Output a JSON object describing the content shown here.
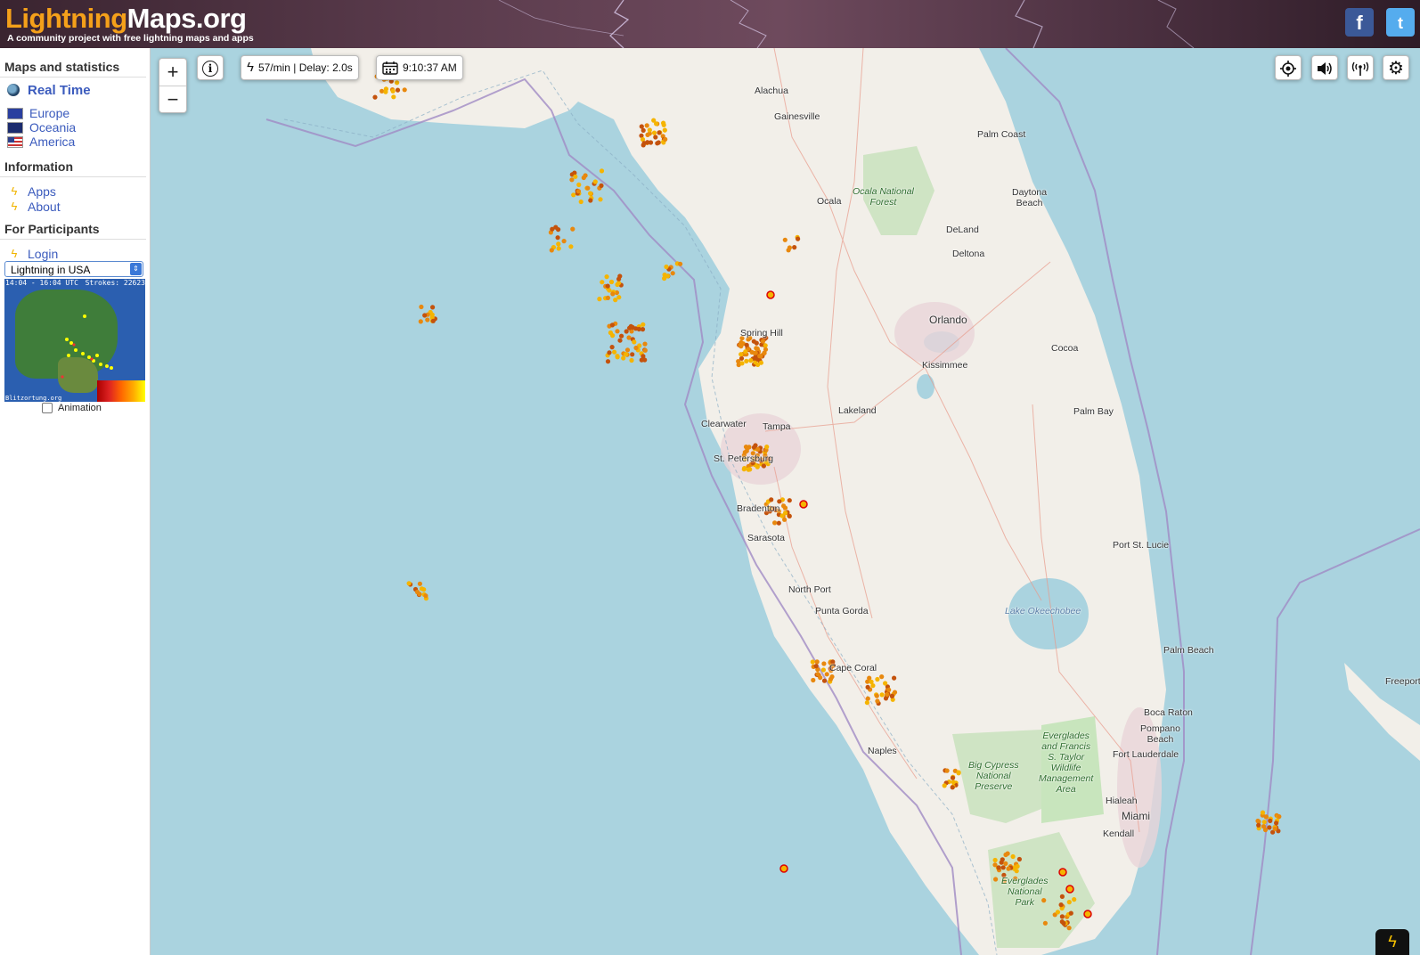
{
  "header": {
    "logo_part1": "Lightning",
    "logo_part2": "Maps.org",
    "tagline": "A community project with free lightning maps and apps",
    "facebook_glyph": "f",
    "twitter_glyph": "t"
  },
  "sidebar": {
    "section_maps": "Maps and statistics",
    "realtime": "Real Time",
    "regions": [
      "Europe",
      "Oceania",
      "America"
    ],
    "section_info": "Information",
    "info_items": [
      "Apps",
      "About"
    ],
    "section_participants": "For Participants",
    "login": "Login",
    "select_value": "Lightning in USA",
    "minimap_time": "14:04 - 16:04 UTC",
    "minimap_strokes": "Strokes: 22623",
    "minimap_source": "Blitzortung.org",
    "animation_label": "Animation"
  },
  "controls": {
    "zoom_in": "+",
    "zoom_out": "−",
    "info": "i",
    "rate": "57/min | Delay: 2.0s",
    "time": "9:10:37 AM"
  },
  "map_labels": [
    {
      "name": "Alachua"
    },
    {
      "name": "Gainesville"
    },
    {
      "name": "Palm Coast"
    },
    {
      "name": "Ocala"
    },
    {
      "name": "Daytona\nBeach"
    },
    {
      "name": "DeLand"
    },
    {
      "name": "Deltona"
    },
    {
      "name": "Orlando"
    },
    {
      "name": "Kissimmee"
    },
    {
      "name": "Cocoa"
    },
    {
      "name": "Lakeland"
    },
    {
      "name": "Palm Bay"
    },
    {
      "name": "Clearwater"
    },
    {
      "name": "Tampa"
    },
    {
      "name": "St. Petersburg"
    },
    {
      "name": "Bradenton"
    },
    {
      "name": "Sarasota"
    },
    {
      "name": "Port St. Lucie"
    },
    {
      "name": "North Port"
    },
    {
      "name": "Punta Gorda"
    },
    {
      "name": "Cape Coral"
    },
    {
      "name": "Palm Beach"
    },
    {
      "name": "Boca Raton"
    },
    {
      "name": "Pompano\nBeach"
    },
    {
      "name": "Fort Lauderdale"
    },
    {
      "name": "Naples"
    },
    {
      "name": "Hialeah"
    },
    {
      "name": "Miami"
    },
    {
      "name": "Kendall"
    },
    {
      "name": "Freeport"
    },
    {
      "name": "Spring Hill"
    }
  ],
  "map_green_labels": [
    {
      "name": "Ocala National\nForest"
    },
    {
      "name": "Big Cypress\nNational\nPreserve"
    },
    {
      "name": "Everglades\nand Francis\nS. Taylor\nWildlife\nManagement\nArea"
    },
    {
      "name": "Everglades\nNational\nPark"
    }
  ],
  "map_lake_label": "Lake Okeechobee",
  "colors": {
    "sea": "#aad3df",
    "land": "#f2efe9",
    "strike_recent": "#f5b400",
    "strike_mid": "#e8880e",
    "strike_old": "#c4520c",
    "link": "#3b5bbd",
    "logo_orange": "#f4a01a"
  },
  "icons": [
    "info-icon",
    "bolt-icon",
    "calendar-icon",
    "locate-icon",
    "sound-icon",
    "signal-icon",
    "gear-icon"
  ]
}
